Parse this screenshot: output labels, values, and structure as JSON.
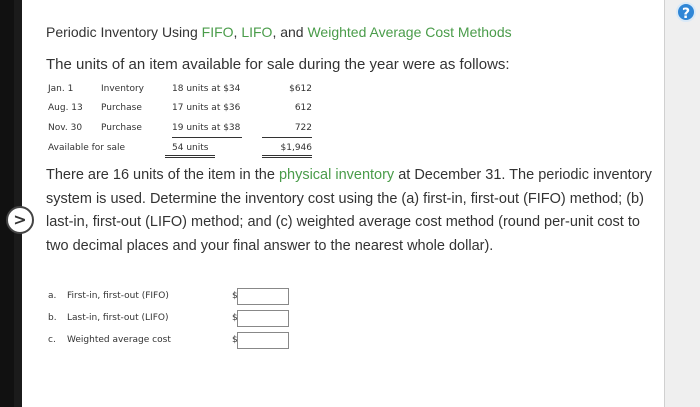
{
  "help": {
    "icon": "?"
  },
  "nav": {
    "icon": ">"
  },
  "title": {
    "part1": "Periodic Inventory Using ",
    "fifo": "FIFO",
    "sep1": ", ",
    "lifo": "LIFO",
    "sep2": ", and ",
    "wavg": "Weighted Average Cost Methods"
  },
  "lead": "The units of an item available for sale during the year were as follows:",
  "rows": [
    {
      "date": "Jan. 1",
      "type": "Inventory",
      "units": "18 units at $34",
      "cost": "$612"
    },
    {
      "date": "Aug. 13",
      "type": "Purchase",
      "units": "17 units at $36",
      "cost": "612"
    },
    {
      "date": "Nov. 30",
      "type": "Purchase",
      "units": "19 units at $38",
      "cost": "722"
    }
  ],
  "total": {
    "label": "Available for sale",
    "units": "54 units",
    "cost": "$1,946"
  },
  "paragraph": {
    "pre": "There are 16 units of the item in the ",
    "link": "physical inventory",
    "post": " at December 31. The periodic inventory system is used. Determine the inventory cost using the (a) first-in, first-out (FIFO) method; (b) last-in, first-out (LIFO) method; and (c) weighted average cost method (round per-unit cost to two decimal places and your final answer to the nearest whole dollar)."
  },
  "questions": [
    {
      "letter": "a.",
      "label": "First-in, first-out (FIFO)",
      "currency": "$",
      "value": ""
    },
    {
      "letter": "b.",
      "label": "Last-in, first-out (LIFO)",
      "currency": "$",
      "value": ""
    },
    {
      "letter": "c.",
      "label": "Weighted average cost",
      "currency": "$",
      "value": ""
    }
  ],
  "colors": {
    "accent_green": "#4a9c4a",
    "help_blue": "#2f86d6"
  }
}
